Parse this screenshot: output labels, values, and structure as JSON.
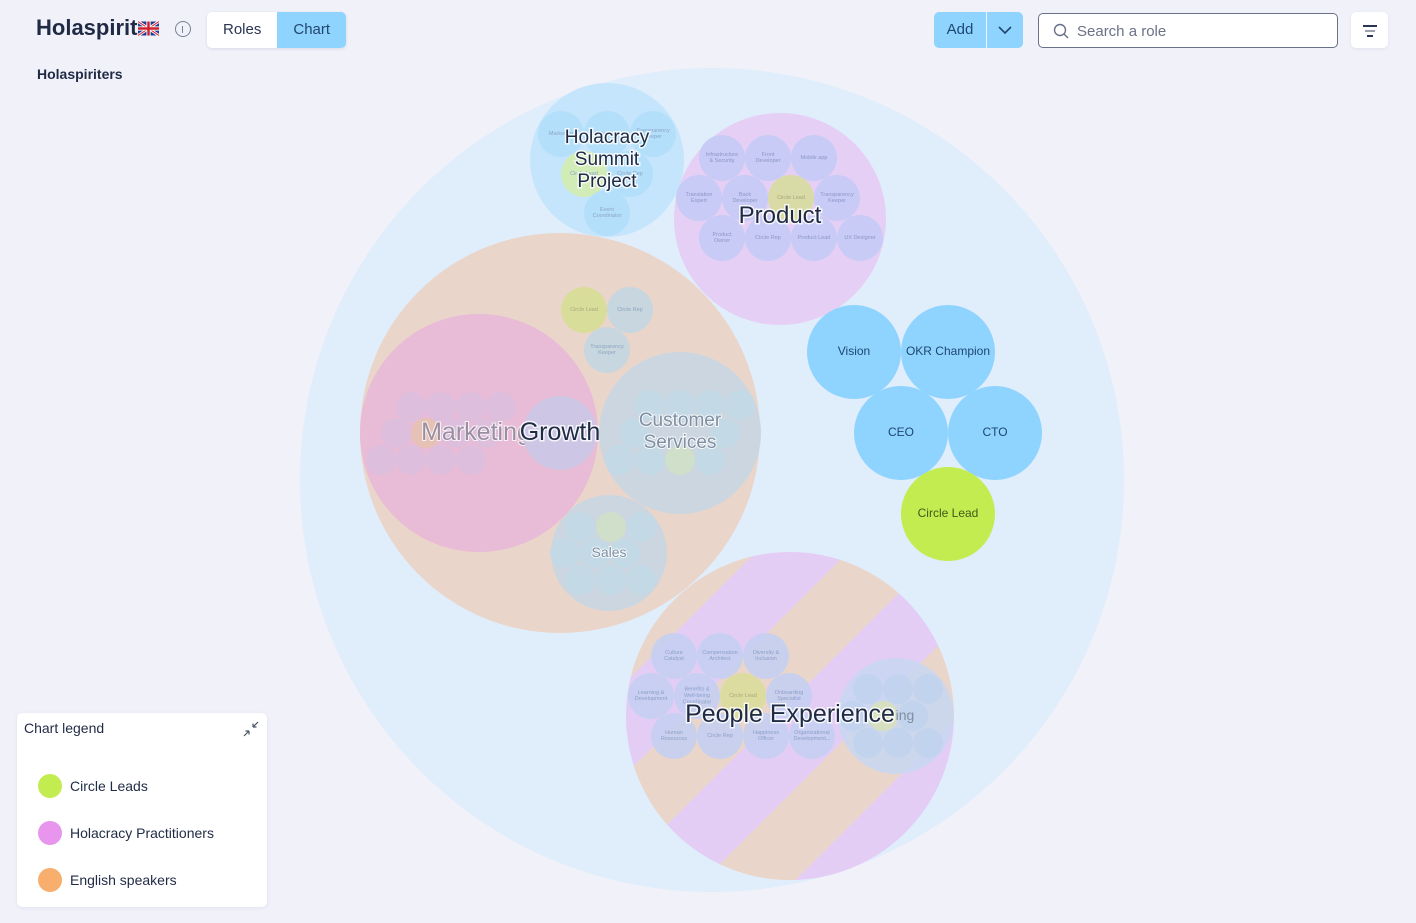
{
  "header": {
    "app_title": "Holaspirit",
    "flag_icon": "uk-flag",
    "info_icon": "info-icon",
    "tabs": [
      {
        "label": "Roles",
        "active": false
      },
      {
        "label": "Chart",
        "active": true
      }
    ],
    "org_name": "Holaspiriters",
    "add_label": "Add",
    "add_caret_icon": "chevron-down-icon",
    "search": {
      "placeholder": "Search a role",
      "value": ""
    },
    "filter_icon": "filter-icon"
  },
  "colors": {
    "page_bg": "#f1f1fa",
    "anchor_circle": "#e0edfb",
    "role_blue": "#8fd4ff",
    "circle_lead_green": "#c3ec50",
    "holacracy_purple": "#e6cff5",
    "english_orange": "#ead5ca",
    "accent": "#8fd4ff"
  },
  "chart": {
    "anchor_circle": "Holaspiriters",
    "circles": [
      {
        "id": "summit",
        "label": "Holacracy Summit Project",
        "label_lines": [
          "Holacracy",
          "Summit",
          "Project"
        ],
        "roles": [
          "Marketing",
          "Holacracy",
          "Transparency Keeper",
          "Circle Lead",
          "Circle Rep",
          "Event Coordinator"
        ]
      },
      {
        "id": "product",
        "label": "Product",
        "roles": [
          "Infrastructure & Security",
          "Front Developer",
          "Mobile app",
          "Translation Expert",
          "Back Developer",
          "Circle Lead",
          "Transparency Keeper",
          "Product Owner",
          "Circle Rep",
          "Product Lead",
          "UX Designer"
        ]
      },
      {
        "id": "growth",
        "label": "Growth",
        "roles": [
          "Circle Lead",
          "Circle Rep",
          "Transparency Keeper"
        ],
        "subcircles": [
          {
            "id": "marketing",
            "label": "Marketing"
          },
          {
            "id": "customer",
            "label": "Customer Services",
            "label_lines": [
              "Customer",
              "Services"
            ]
          },
          {
            "id": "sales",
            "label": "Sales"
          }
        ]
      },
      {
        "id": "people",
        "label": "People Experience",
        "roles": [
          "Culture Catalyst",
          "Compensation Architect",
          "Diversity & Inclusion",
          "Learning & Development",
          "Benefits & Well-being Coordinator",
          "Circle Lead",
          "Onboarding Specialist",
          "Human Resources",
          "Circle Rep",
          "Happiness Officer",
          "Organizational Development..."
        ],
        "subcircles": [
          {
            "id": "recruiting",
            "label": "Recruiting",
            "visible_text": "ing"
          }
        ]
      }
    ],
    "anchor_roles": [
      {
        "label": "Vision",
        "type": "role"
      },
      {
        "label": "OKR Champion",
        "type": "role"
      },
      {
        "label": "CEO",
        "type": "role"
      },
      {
        "label": "CTO",
        "type": "role"
      },
      {
        "label": "Circle Lead",
        "type": "lead"
      }
    ]
  },
  "legend": {
    "title": "Chart legend",
    "collapse_icon": "collapse-icon",
    "items": [
      {
        "label": "Circle Leads",
        "color": "#c3ec50"
      },
      {
        "label": "Holacracy Practitioners",
        "color": "#e895ee"
      },
      {
        "label": "English speakers",
        "color": "#f8ae6c"
      }
    ]
  }
}
